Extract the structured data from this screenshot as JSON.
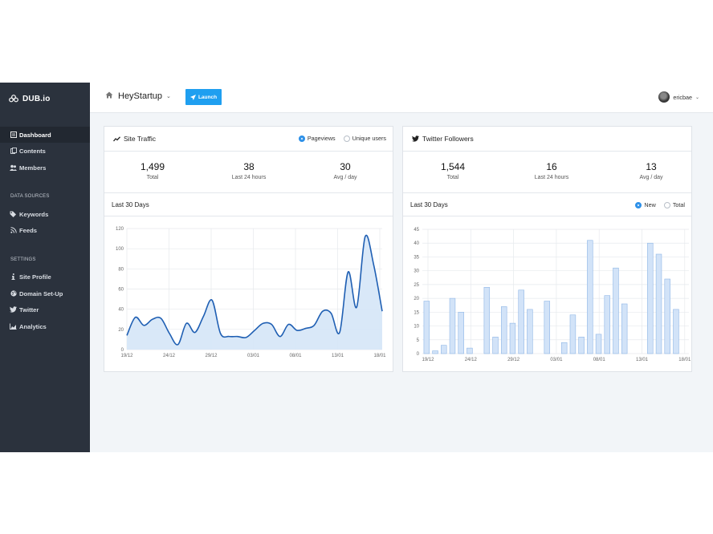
{
  "app": {
    "logo": "DUB.io",
    "site_name": "HeyStartup",
    "launch_label": "Launch",
    "user_name": "ericbae"
  },
  "sidebar": {
    "items": [
      {
        "label": "Dashboard",
        "icon": "dashboard-icon"
      },
      {
        "label": "Contents",
        "icon": "files-icon"
      },
      {
        "label": "Members",
        "icon": "users-icon"
      }
    ],
    "data_sources_heading": "DATA SOURCES",
    "data_sources": [
      {
        "label": "Keywords",
        "icon": "tags-icon"
      },
      {
        "label": "Feeds",
        "icon": "rss-icon"
      }
    ],
    "settings_heading": "SETTINGS",
    "settings": [
      {
        "label": "Site Profile",
        "icon": "info-icon"
      },
      {
        "label": "Domain Set-Up",
        "icon": "globe-icon"
      },
      {
        "label": "Twitter",
        "icon": "twitter-icon"
      },
      {
        "label": "Analytics",
        "icon": "area-chart-icon"
      }
    ]
  },
  "colors": {
    "sidebar": "#2b323d",
    "accent": "#1f9ff0",
    "line": "#1f5fb3",
    "area": "#d5e5f7",
    "bar": "#d2e3f8",
    "bar_stroke": "#8fb6e6"
  },
  "site_traffic": {
    "title": "Site Traffic",
    "options": [
      "Pageviews",
      "Unique users"
    ],
    "selected": "Pageviews",
    "stats": [
      {
        "value": "1,499",
        "label": "Total"
      },
      {
        "value": "38",
        "label": "Last 24 hours"
      },
      {
        "value": "30",
        "label": "Avg / day"
      }
    ],
    "subtitle": "Last 30 Days"
  },
  "twitter": {
    "title": "Twitter Followers",
    "options": [
      "New",
      "Total"
    ],
    "selected": "New",
    "stats": [
      {
        "value": "1,544",
        "label": "Total"
      },
      {
        "value": "16",
        "label": "Last 24 hours"
      },
      {
        "value": "13",
        "label": "Avg / day"
      }
    ],
    "subtitle": "Last 30 Days"
  },
  "chart_data": [
    {
      "type": "area",
      "title": "",
      "x_ticks": [
        "19/12",
        "24/12",
        "29/12",
        "03/01",
        "08/01",
        "13/01",
        "18/01"
      ],
      "ylim": [
        0,
        120
      ],
      "y_ticks": [
        0,
        20,
        40,
        60,
        80,
        100,
        120
      ],
      "grid": true,
      "days": 31,
      "values": [
        14,
        32,
        24,
        30,
        31,
        16,
        5,
        26,
        17,
        33,
        49,
        16,
        13,
        13,
        12,
        19,
        26,
        25,
        13,
        25,
        19,
        21,
        24,
        38,
        36,
        17,
        77,
        42,
        112,
        84,
        38
      ]
    },
    {
      "type": "bar",
      "title": "",
      "x_ticks": [
        "19/12",
        "24/12",
        "29/12",
        "03/01",
        "08/01",
        "13/01",
        "18/01"
      ],
      "ylim": [
        0,
        45
      ],
      "y_ticks": [
        0,
        5,
        10,
        15,
        20,
        25,
        30,
        35,
        40,
        45
      ],
      "grid": true,
      "days": 31,
      "values": [
        19,
        1,
        3,
        20,
        15,
        2,
        0,
        24,
        6,
        17,
        11,
        23,
        16,
        0,
        19,
        0,
        4,
        14,
        6,
        41,
        7,
        21,
        31,
        18,
        0,
        0,
        40,
        36,
        27,
        16,
        0
      ]
    }
  ]
}
